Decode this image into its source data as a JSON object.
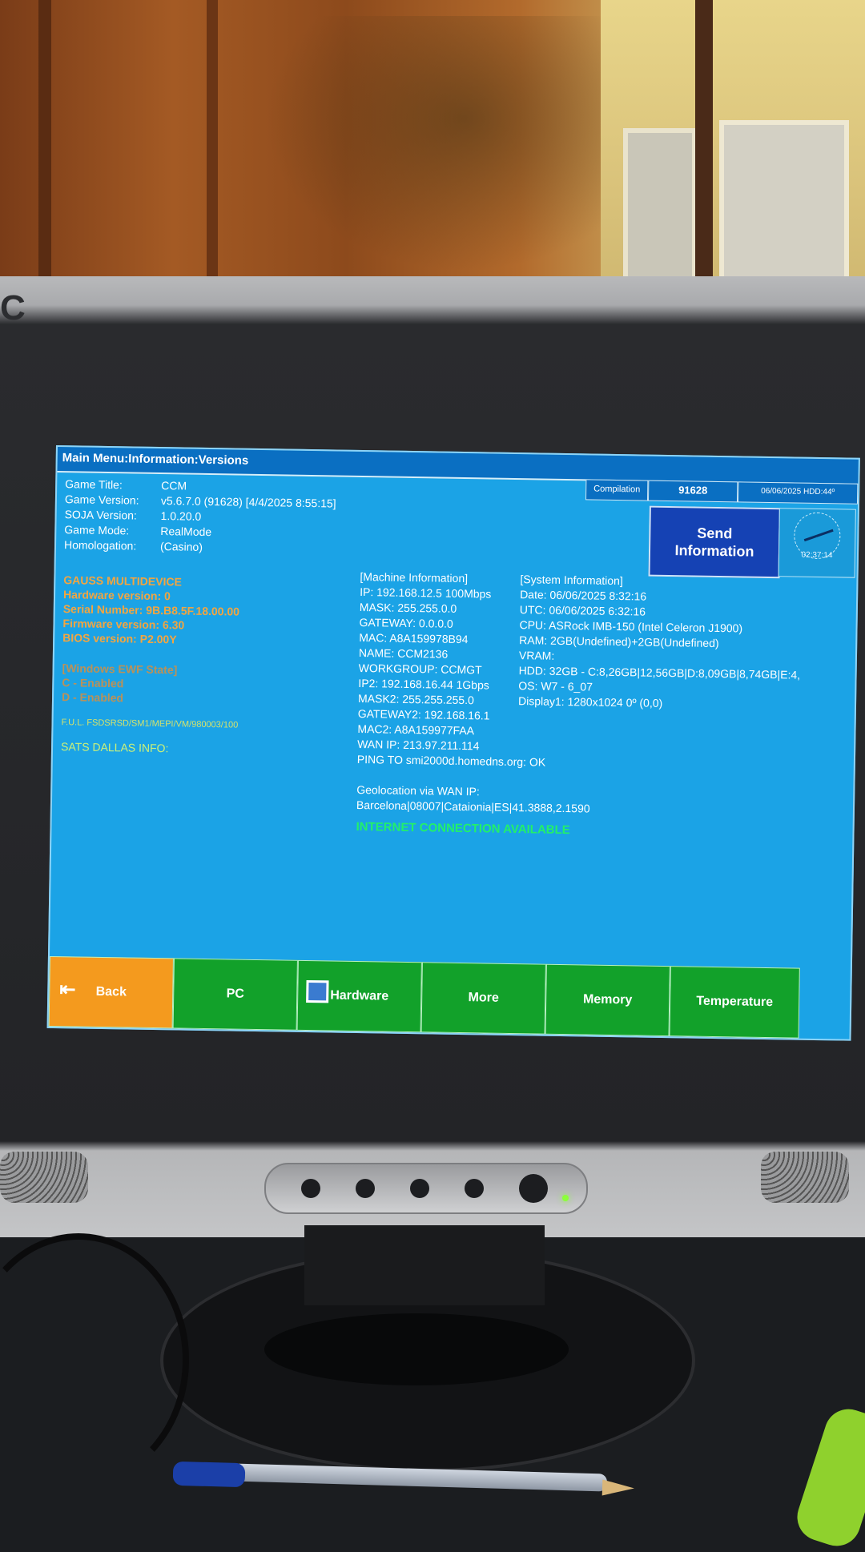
{
  "screen": {
    "title": "Main Menu:Information:Versions",
    "compilation_label": "Compilation",
    "compilation_value": "91628",
    "status": "06/06/2025 HDD:44º",
    "send_button": "Send\nInformation",
    "clock_time": "02:37:14"
  },
  "game_info": [
    {
      "label": "Game Title:",
      "value": "CCM"
    },
    {
      "label": "Game Version:",
      "value": "v5.6.7.0 (91628) [4/4/2025 8:55:15]"
    },
    {
      "label": "SOJA Version:",
      "value": "1.0.20.0"
    },
    {
      "label": "Game Mode:",
      "value": "RealMode"
    },
    {
      "label": "Homologation:",
      "value": "(Casino)"
    }
  ],
  "device_info": [
    "GAUSS MULTIDEVICE",
    "Hardware version: 0",
    "Serial Number: 9B.B8.5F.18.00.00",
    "Firmware version: 6.30",
    "BIOS version: P2.00Y"
  ],
  "ewf_info": [
    "[Windows EWF State]",
    "C  - Enabled",
    "D  - Enabled"
  ],
  "faint_line": "F.U.L. FSDSRSD/SM1/MEPI/VM/980003/100",
  "sats_info": "SATS DALLAS INFO:",
  "machine_info": [
    "[Machine Information]",
    "IP: 192.168.12.5 100Mbps",
    "MASK: 255.255.0.0",
    "GATEWAY: 0.0.0.0",
    "MAC: A8A159978B94",
    "NAME: CCM2136",
    "WORKGROUP: CCMGT",
    "IP2: 192.168.16.44 1Gbps",
    "MASK2: 255.255.255.0",
    "GATEWAY2: 192.168.16.1",
    "MAC2: A8A159977FAA",
    "WAN IP: 213.97.211.114",
    "PING TO smi2000d.homedns.org: OK"
  ],
  "system_info": [
    "[System Information]",
    "Date: 06/06/2025 8:32:16",
    "UTC: 06/06/2025 6:32:16",
    "CPU: ASRock IMB-150 (Intel Celeron J1900)",
    "RAM: 2GB(Undefined)+2GB(Undefined)",
    "VRAM:",
    "HDD: 32GB - C:8,26GB|12,56GB|D:8,09GB|8,74GB|E:4,",
    "OS: W7 - 6_07",
    "Display1: 1280x1024 0º (0,0)"
  ],
  "geolocation": {
    "label": "Geolocation via WAN IP:",
    "value": "Barcelona|08007|Cataionia|ES|41.3888,2.1590"
  },
  "connection_status": "INTERNET CONNECTION AVAILABLE",
  "nav": [
    {
      "label": "Back"
    },
    {
      "label": "PC"
    },
    {
      "label": "Hardware"
    },
    {
      "label": "More"
    },
    {
      "label": "Memory"
    },
    {
      "label": "Temperature"
    }
  ],
  "colors": {
    "screen_bg": "#1ba3e6",
    "title_bar": "#0a6fc2",
    "nav_green": "#12a12a",
    "back_orange": "#f49a1e",
    "send_blue": "#1542b4",
    "status_green": "#22f06a"
  },
  "monitor_brand": "C"
}
